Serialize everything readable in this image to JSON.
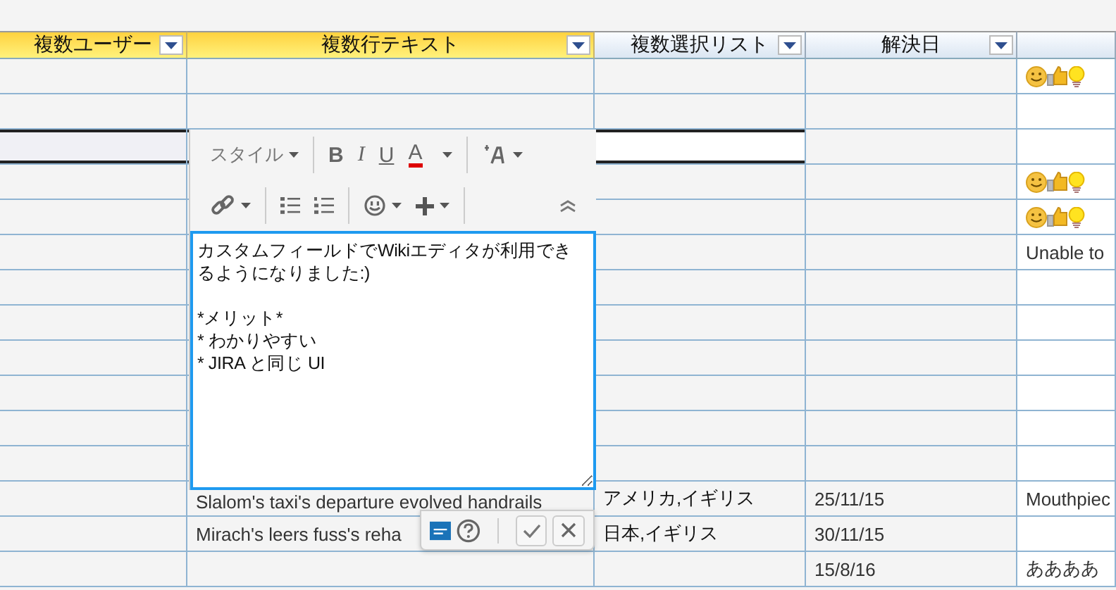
{
  "columns": [
    {
      "label": "複数ユーザー",
      "highlighted": true,
      "filter": true
    },
    {
      "label": "複数行テキスト",
      "highlighted": true,
      "filter": true
    },
    {
      "label": "複数選択リスト",
      "highlighted": false,
      "filter": true
    },
    {
      "label": "解決日",
      "highlighted": false,
      "filter": true
    },
    {
      "highlighted": false,
      "filter": false
    }
  ],
  "rows": [
    {
      "editing": false,
      "reactions": true
    },
    {
      "editing": false,
      "reactions": false
    },
    {
      "editing": true,
      "reactions": false
    },
    {
      "editing": false,
      "reactions": true
    },
    {
      "editing": false,
      "reactions": true
    },
    {
      "editing": false,
      "reactions": false,
      "column_5": "Unable to"
    },
    {
      "editing": false,
      "reactions": false
    },
    {
      "editing": false,
      "reactions": false
    },
    {
      "editing": false,
      "reactions": false
    },
    {
      "editing": false,
      "reactions": false
    },
    {
      "editing": false,
      "reactions": false
    },
    {
      "editing": false,
      "reactions": false
    },
    {
      "editing": false,
      "reactions": false,
      "multiline_text": "Slalom's taxi's departure evolved handrails",
      "multi_select": "アメリカ,イギリス",
      "resolved": "25/11/15",
      "column_5": "Mouthpiec"
    },
    {
      "editing": false,
      "reactions": false,
      "multiline_text": "Mirach's leers fuss's reha",
      "multi_select": "日本,イギリス",
      "resolved": "30/11/15"
    },
    {
      "editing": false,
      "reactions": false,
      "resolved": "15/8/16",
      "column_5": "ああああ"
    }
  ],
  "editor": {
    "toolbar": [
      [
        [
          {
            "kind": "dropdown",
            "label": "スタイル"
          }
        ],
        [
          {
            "kind": "bold",
            "label": "B"
          },
          {
            "kind": "italic",
            "label": "I"
          },
          {
            "kind": "underline",
            "label": "U"
          },
          {
            "kind": "color",
            "label": "A"
          },
          {
            "kind": "caret"
          }
        ],
        [
          {
            "kind": "textsize"
          }
        ]
      ],
      [
        [
          {
            "kind": "link"
          }
        ],
        [
          {
            "kind": "bullets"
          },
          {
            "kind": "numbers"
          }
        ],
        [
          {
            "kind": "emoji"
          },
          {
            "kind": "plus"
          }
        ],
        [
          {
            "kind": "collapse"
          }
        ]
      ]
    ],
    "value": "カスタムフィールドでWikiエディタが利用できるようになりました:)\n\n*メリット*\n* わかりやすい\n* JIRA と同じ UI"
  },
  "actions": [
    {
      "kind": "wiki"
    },
    {
      "kind": "help"
    },
    {
      "kind": "confirm"
    },
    {
      "kind": "cancel"
    }
  ]
}
